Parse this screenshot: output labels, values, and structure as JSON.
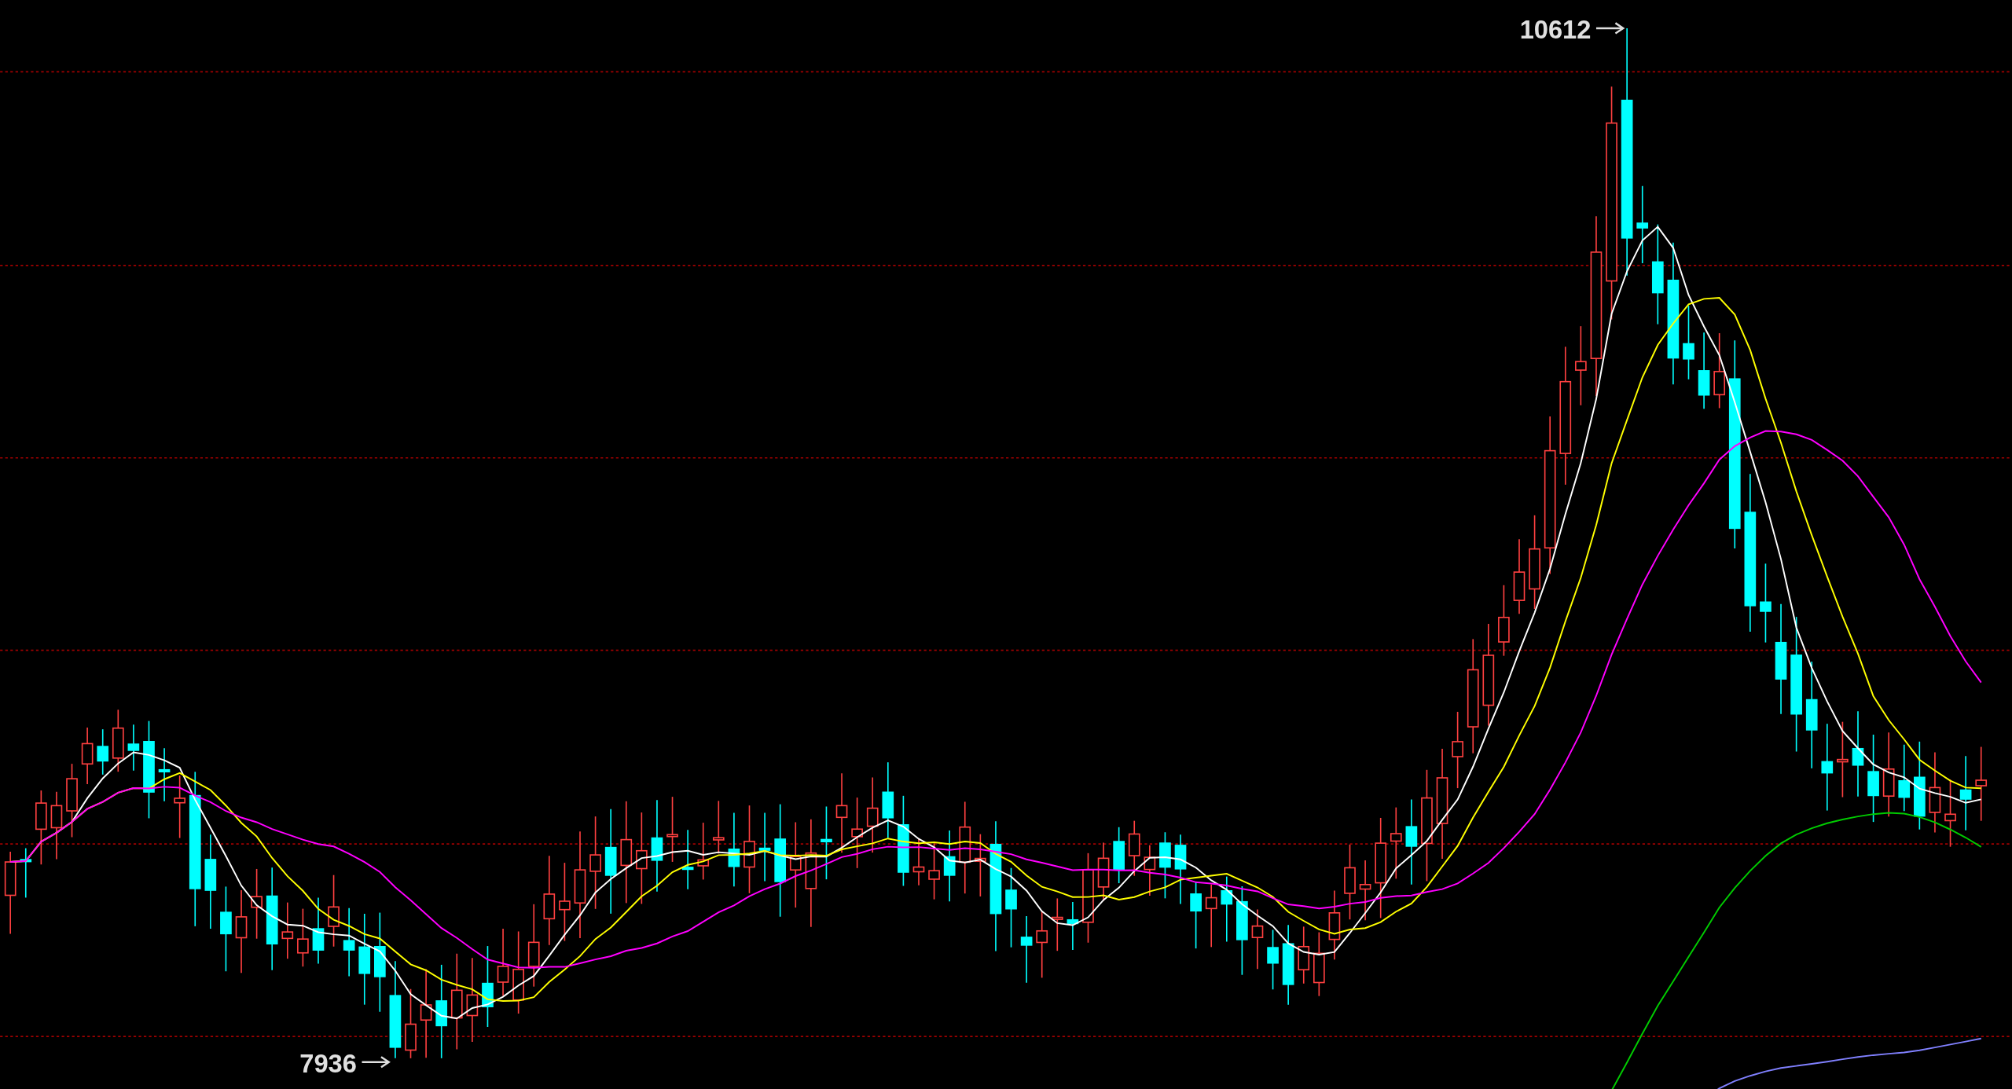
{
  "chart": {
    "high_label": "10612",
    "low_label": "7936"
  }
}
